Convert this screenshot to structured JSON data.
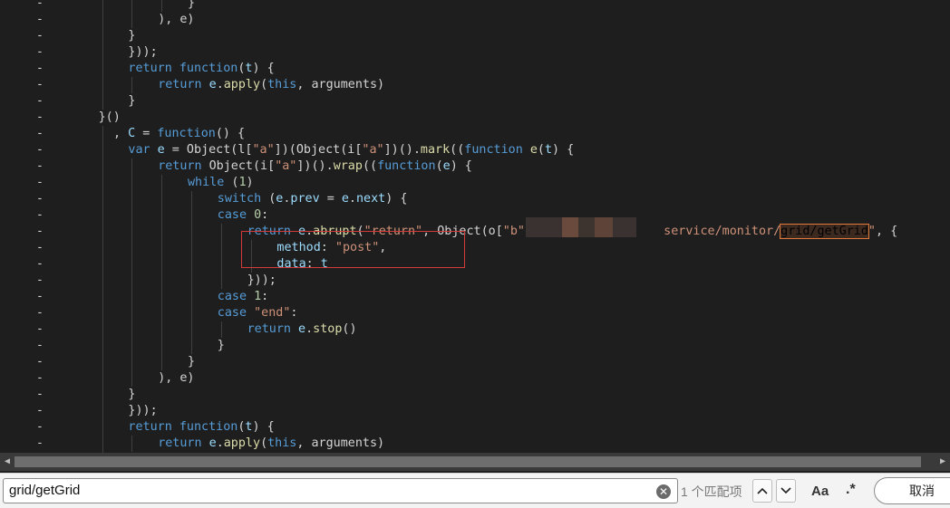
{
  "code_lines": [
    {
      "gutter": "-",
      "indent": 20,
      "tokens": [
        {
          "c": "pl",
          "t": "}"
        }
      ]
    },
    {
      "gutter": "-",
      "indent": 16,
      "tokens": [
        {
          "c": "pl",
          "t": "), e)"
        }
      ]
    },
    {
      "gutter": "-",
      "indent": 12,
      "tokens": [
        {
          "c": "pl",
          "t": "}"
        }
      ]
    },
    {
      "gutter": "-",
      "indent": 12,
      "tokens": [
        {
          "c": "pl",
          "t": "}));"
        }
      ]
    },
    {
      "gutter": "-",
      "indent": 12,
      "tokens": [
        {
          "c": "kw",
          "t": "return "
        },
        {
          "c": "kw",
          "t": "function"
        },
        {
          "c": "pl",
          "t": "("
        },
        {
          "c": "prop",
          "t": "t"
        },
        {
          "c": "pl",
          "t": ") {"
        }
      ]
    },
    {
      "gutter": "-",
      "indent": 16,
      "tokens": [
        {
          "c": "kw",
          "t": "return "
        },
        {
          "c": "prop",
          "t": "e"
        },
        {
          "c": "pl",
          "t": "."
        },
        {
          "c": "fn",
          "t": "apply"
        },
        {
          "c": "pl",
          "t": "("
        },
        {
          "c": "kw",
          "t": "this"
        },
        {
          "c": "pl",
          "t": ", arguments)"
        }
      ]
    },
    {
      "gutter": "-",
      "indent": 12,
      "tokens": [
        {
          "c": "pl",
          "t": "}"
        }
      ]
    },
    {
      "gutter": "-",
      "indent": 8,
      "tokens": [
        {
          "c": "pl",
          "t": "}()"
        }
      ]
    },
    {
      "gutter": "-",
      "indent": 10,
      "tokens": [
        {
          "c": "pl",
          "t": ", "
        },
        {
          "c": "prop",
          "t": "C"
        },
        {
          "c": "pl",
          "t": " = "
        },
        {
          "c": "kw",
          "t": "function"
        },
        {
          "c": "pl",
          "t": "() {"
        }
      ]
    },
    {
      "gutter": "-",
      "indent": 12,
      "tokens": [
        {
          "c": "kw",
          "t": "var "
        },
        {
          "c": "prop",
          "t": "e"
        },
        {
          "c": "pl",
          "t": " = Object(l["
        },
        {
          "c": "str",
          "t": "\"a\""
        },
        {
          "c": "pl",
          "t": "])(Object(i["
        },
        {
          "c": "str",
          "t": "\"a\""
        },
        {
          "c": "pl",
          "t": "])()."
        },
        {
          "c": "fn",
          "t": "mark"
        },
        {
          "c": "pl",
          "t": "(("
        },
        {
          "c": "kw",
          "t": "function"
        },
        {
          "c": "pl",
          "t": " "
        },
        {
          "c": "fn",
          "t": "e"
        },
        {
          "c": "pl",
          "t": "("
        },
        {
          "c": "prop",
          "t": "t"
        },
        {
          "c": "pl",
          "t": ") {"
        }
      ]
    },
    {
      "gutter": "-",
      "indent": 16,
      "tokens": [
        {
          "c": "kw",
          "t": "return "
        },
        {
          "c": "pl",
          "t": "Object(i["
        },
        {
          "c": "str",
          "t": "\"a\""
        },
        {
          "c": "pl",
          "t": "])()."
        },
        {
          "c": "fn",
          "t": "wrap"
        },
        {
          "c": "pl",
          "t": "(("
        },
        {
          "c": "kw",
          "t": "function"
        },
        {
          "c": "pl",
          "t": "("
        },
        {
          "c": "prop",
          "t": "e"
        },
        {
          "c": "pl",
          "t": ") {"
        }
      ]
    },
    {
      "gutter": "-",
      "indent": 20,
      "tokens": [
        {
          "c": "kw",
          "t": "while "
        },
        {
          "c": "pl",
          "t": "("
        },
        {
          "c": "num",
          "t": "1"
        },
        {
          "c": "pl",
          "t": ")"
        }
      ]
    },
    {
      "gutter": "-",
      "indent": 24,
      "tokens": [
        {
          "c": "kw",
          "t": "switch "
        },
        {
          "c": "pl",
          "t": "("
        },
        {
          "c": "prop",
          "t": "e"
        },
        {
          "c": "pl",
          "t": "."
        },
        {
          "c": "prop",
          "t": "prev"
        },
        {
          "c": "pl",
          "t": " = "
        },
        {
          "c": "prop",
          "t": "e"
        },
        {
          "c": "pl",
          "t": "."
        },
        {
          "c": "prop",
          "t": "next"
        },
        {
          "c": "pl",
          "t": ") {"
        }
      ]
    },
    {
      "gutter": "-",
      "indent": 24,
      "tokens": [
        {
          "c": "kw",
          "t": "case "
        },
        {
          "c": "num",
          "t": "0"
        },
        {
          "c": "pl",
          "t": ":"
        }
      ]
    },
    {
      "gutter": "-",
      "indent": 28,
      "tokens": [
        {
          "c": "kw",
          "t": "return "
        },
        {
          "c": "prop",
          "t": "e"
        },
        {
          "c": "pl",
          "t": "."
        },
        {
          "c": "fn",
          "t": "abrupt"
        },
        {
          "c": "pl",
          "t": "("
        },
        {
          "c": "str",
          "t": "\"return\""
        },
        {
          "c": "pl",
          "t": ", Object(o["
        },
        {
          "c": "str",
          "t": "\"b\""
        },
        {
          "c": "pl",
          "t": "])("
        },
        {
          "c": "pl",
          "t": "                "
        },
        {
          "c": "str",
          "t": "service/monitor/"
        },
        {
          "c": "hl",
          "t": "grid/getGrid"
        },
        {
          "c": "str",
          "t": "\""
        },
        {
          "c": "pl",
          "t": ", {"
        }
      ]
    },
    {
      "gutter": "-",
      "indent": 32,
      "tokens": [
        {
          "c": "prop",
          "t": "method"
        },
        {
          "c": "pl",
          "t": ": "
        },
        {
          "c": "str",
          "t": "\"post\""
        },
        {
          "c": "pl",
          "t": ","
        }
      ]
    },
    {
      "gutter": "-",
      "indent": 32,
      "tokens": [
        {
          "c": "prop",
          "t": "data"
        },
        {
          "c": "pl",
          "t": ": "
        },
        {
          "c": "prop",
          "t": "t"
        }
      ]
    },
    {
      "gutter": "-",
      "indent": 28,
      "tokens": [
        {
          "c": "pl",
          "t": "}));"
        }
      ]
    },
    {
      "gutter": "-",
      "indent": 24,
      "tokens": [
        {
          "c": "kw",
          "t": "case "
        },
        {
          "c": "num",
          "t": "1"
        },
        {
          "c": "pl",
          "t": ":"
        }
      ]
    },
    {
      "gutter": "-",
      "indent": 24,
      "tokens": [
        {
          "c": "kw",
          "t": "case "
        },
        {
          "c": "str",
          "t": "\"end\""
        },
        {
          "c": "pl",
          "t": ":"
        }
      ]
    },
    {
      "gutter": "-",
      "indent": 28,
      "tokens": [
        {
          "c": "kw",
          "t": "return "
        },
        {
          "c": "prop",
          "t": "e"
        },
        {
          "c": "pl",
          "t": "."
        },
        {
          "c": "fn",
          "t": "stop"
        },
        {
          "c": "pl",
          "t": "()"
        }
      ]
    },
    {
      "gutter": "-",
      "indent": 24,
      "tokens": [
        {
          "c": "pl",
          "t": "}"
        }
      ]
    },
    {
      "gutter": "-",
      "indent": 20,
      "tokens": [
        {
          "c": "pl",
          "t": "}"
        }
      ]
    },
    {
      "gutter": "-",
      "indent": 16,
      "tokens": [
        {
          "c": "pl",
          "t": "), e)"
        }
      ]
    },
    {
      "gutter": "-",
      "indent": 12,
      "tokens": [
        {
          "c": "pl",
          "t": "}"
        }
      ]
    },
    {
      "gutter": "-",
      "indent": 12,
      "tokens": [
        {
          "c": "pl",
          "t": "}));"
        }
      ]
    },
    {
      "gutter": "-",
      "indent": 12,
      "tokens": [
        {
          "c": "kw",
          "t": "return "
        },
        {
          "c": "kw",
          "t": "function"
        },
        {
          "c": "pl",
          "t": "("
        },
        {
          "c": "prop",
          "t": "t"
        },
        {
          "c": "pl",
          "t": ") {"
        }
      ]
    },
    {
      "gutter": "-",
      "indent": 16,
      "tokens": [
        {
          "c": "kw",
          "t": "return "
        },
        {
          "c": "prop",
          "t": "e"
        },
        {
          "c": "pl",
          "t": "."
        },
        {
          "c": "fn",
          "t": "apply"
        },
        {
          "c": "pl",
          "t": "("
        },
        {
          "c": "kw",
          "t": "this"
        },
        {
          "c": "pl",
          "t": ", arguments)"
        }
      ]
    },
    {
      "gutter": "",
      "indent": 12,
      "tokens": [
        {
          "c": "pl",
          "t": "}"
        }
      ]
    }
  ],
  "find": {
    "query": "grid/getGrid",
    "match_count": "1 个匹配项",
    "match_case_label": "Aa",
    "regex_label": ".*",
    "cancel_label": "取消"
  },
  "colors": {
    "background": "#1e1e1e",
    "keyword": "#569cd6",
    "function": "#dcdcaa",
    "string": "#ce9178",
    "property": "#9cdcfe",
    "match_highlight": "#e0783c",
    "annotation_box": "#d33b3b"
  }
}
